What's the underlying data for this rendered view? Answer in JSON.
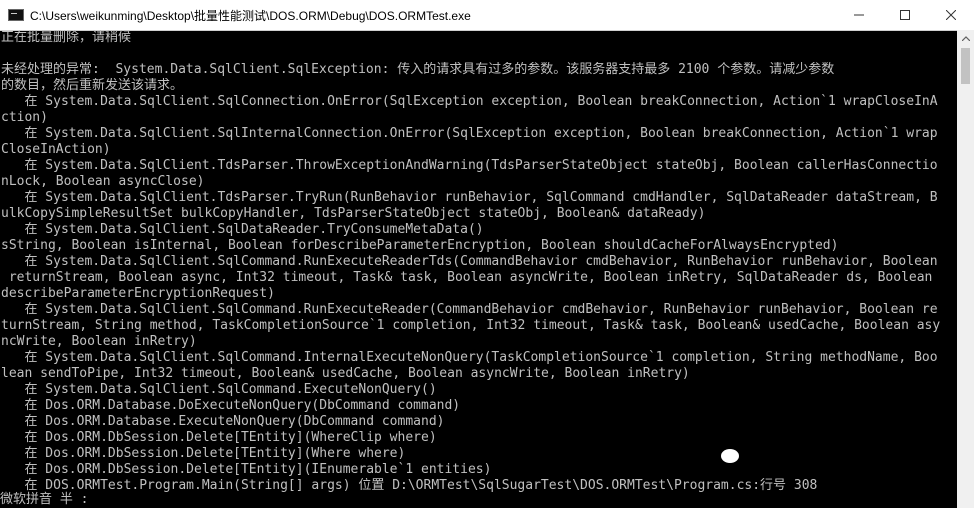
{
  "window": {
    "title": "C:\\Users\\weikunming\\Desktop\\批量性能测试\\DOS.ORM\\Debug\\DOS.ORMTest.exe",
    "minimize_icon": "minimize-icon",
    "maximize_icon": "maximize-icon",
    "close_icon": "close-icon"
  },
  "console": {
    "lines": [
      "正在批量删除，请稍候",
      "",
      "未经处理的异常:  System.Data.SqlClient.SqlException: 传入的请求具有过多的参数。该服务器支持最多 2100 个参数。请减少参数",
      "的数目，然后重新发送该请求。",
      "   在 System.Data.SqlClient.SqlConnection.OnError(SqlException exception, Boolean breakConnection, Action`1 wrapCloseInA",
      "ction)",
      "   在 System.Data.SqlClient.SqlInternalConnection.OnError(SqlException exception, Boolean breakConnection, Action`1 wrap",
      "CloseInAction)",
      "   在 System.Data.SqlClient.TdsParser.ThrowExceptionAndWarning(TdsParserStateObject stateObj, Boolean callerHasConnectio",
      "nLock, Boolean asyncClose)",
      "   在 System.Data.SqlClient.TdsParser.TryRun(RunBehavior runBehavior, SqlCommand cmdHandler, SqlDataReader dataStream, B",
      "ulkCopySimpleResultSet bulkCopyHandler, TdsParserStateObject stateObj, Boolean& dataReady)",
      "   在 System.Data.SqlClient.SqlDataReader.TryConsumeMetaData()",
      "sString, Boolean isInternal, Boolean forDescribeParameterEncryption, Boolean shouldCacheForAlwaysEncrypted)",
      "   在 System.Data.SqlClient.SqlCommand.RunExecuteReaderTds(CommandBehavior cmdBehavior, RunBehavior runBehavior, Boolean",
      " returnStream, Boolean async, Int32 timeout, Task& task, Boolean asyncWrite, Boolean inRetry, SqlDataReader ds, Boolean",
      "describeParameterEncryptionRequest)",
      "   在 System.Data.SqlClient.SqlCommand.RunExecuteReader(CommandBehavior cmdBehavior, RunBehavior runBehavior, Boolean re",
      "turnStream, String method, TaskCompletionSource`1 completion, Int32 timeout, Task& task, Boolean& usedCache, Boolean asy",
      "ncWrite, Boolean inRetry)",
      "   在 System.Data.SqlClient.SqlCommand.InternalExecuteNonQuery(TaskCompletionSource`1 completion, String methodName, Boo",
      "lean sendToPipe, Int32 timeout, Boolean& usedCache, Boolean asyncWrite, Boolean inRetry)",
      "   在 System.Data.SqlClient.SqlCommand.ExecuteNonQuery()",
      "   在 Dos.ORM.Database.DoExecuteNonQuery(DbCommand command)",
      "   在 Dos.ORM.Database.ExecuteNonQuery(DbCommand command)",
      "   在 Dos.ORM.DbSession.Delete[TEntity](WhereClip where)",
      "   在 Dos.ORM.DbSession.Delete[TEntity](Where where)",
      "   在 Dos.ORM.DbSession.Delete[TEntity](IEnumerable`1 entities)",
      "   在 DOS.ORMTest.Program.Main(String[] args) 位置 D:\\ORMTest\\SqlSugarTest\\DOS.ORMTest\\Program.cs:行号 308"
    ],
    "ime_status": "微软拼音 半 :"
  },
  "colors": {
    "console_bg": "#000000",
    "console_fg": "#c0c0c0",
    "titlebar_bg": "#ffffff"
  }
}
